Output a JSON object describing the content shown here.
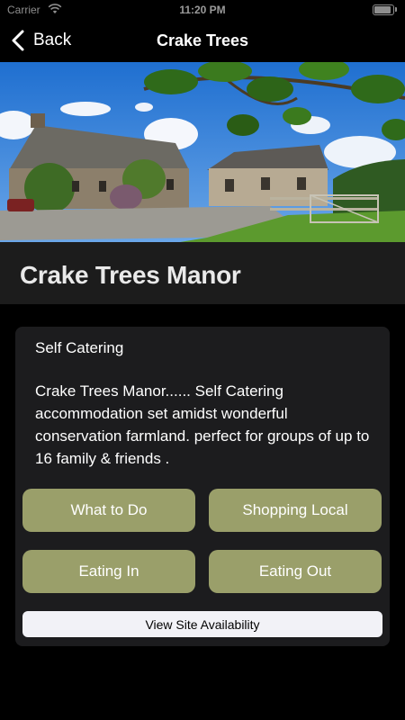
{
  "status_bar": {
    "carrier": "Carrier",
    "time": "11:20 PM",
    "wifi_icon": "wifi-icon",
    "battery_icon": "battery-icon"
  },
  "nav": {
    "back_label": "Back",
    "title": "Crake Trees",
    "back_icon": "chevron-left-icon"
  },
  "hero": {
    "image_description_icon": "farmhouse-photo"
  },
  "place": {
    "title": "Crake Trees Manor"
  },
  "card": {
    "category": "Self Catering",
    "description": "Crake Trees Manor...... Self Catering accommodation set amidst wonderful conservation farmland. perfect for groups of up to 16 family & friends .",
    "buttons": {
      "what_to_do": "What to Do",
      "shopping_local": "Shopping Local",
      "eating_in": "Eating In",
      "eating_out": "Eating Out"
    },
    "availability": "View Site Availability"
  },
  "colors": {
    "accent_button": "#9a9f6a",
    "card_bg": "#1c1c1e",
    "title_band": "#1c1c1c"
  }
}
